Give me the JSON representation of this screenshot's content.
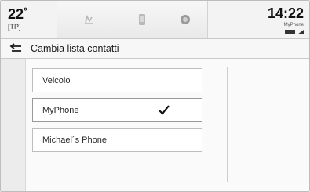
{
  "status_bar": {
    "temperature": "22",
    "degree": "°",
    "zone_label": "[TP]",
    "time": "14:22",
    "device": "MyPhone",
    "tabs": [
      {
        "icon": "music-icon"
      },
      {
        "icon": "phone-icon"
      },
      {
        "icon": "settings-icon"
      }
    ]
  },
  "header": {
    "back_icon": "back-arrow-icon",
    "title": "Cambia lista contatti"
  },
  "contacts_list": {
    "items": [
      {
        "label": "Veicolo",
        "selected": false
      },
      {
        "label": "MyPhone",
        "selected": true
      },
      {
        "label": "Michael´s Phone",
        "selected": false
      }
    ]
  }
}
